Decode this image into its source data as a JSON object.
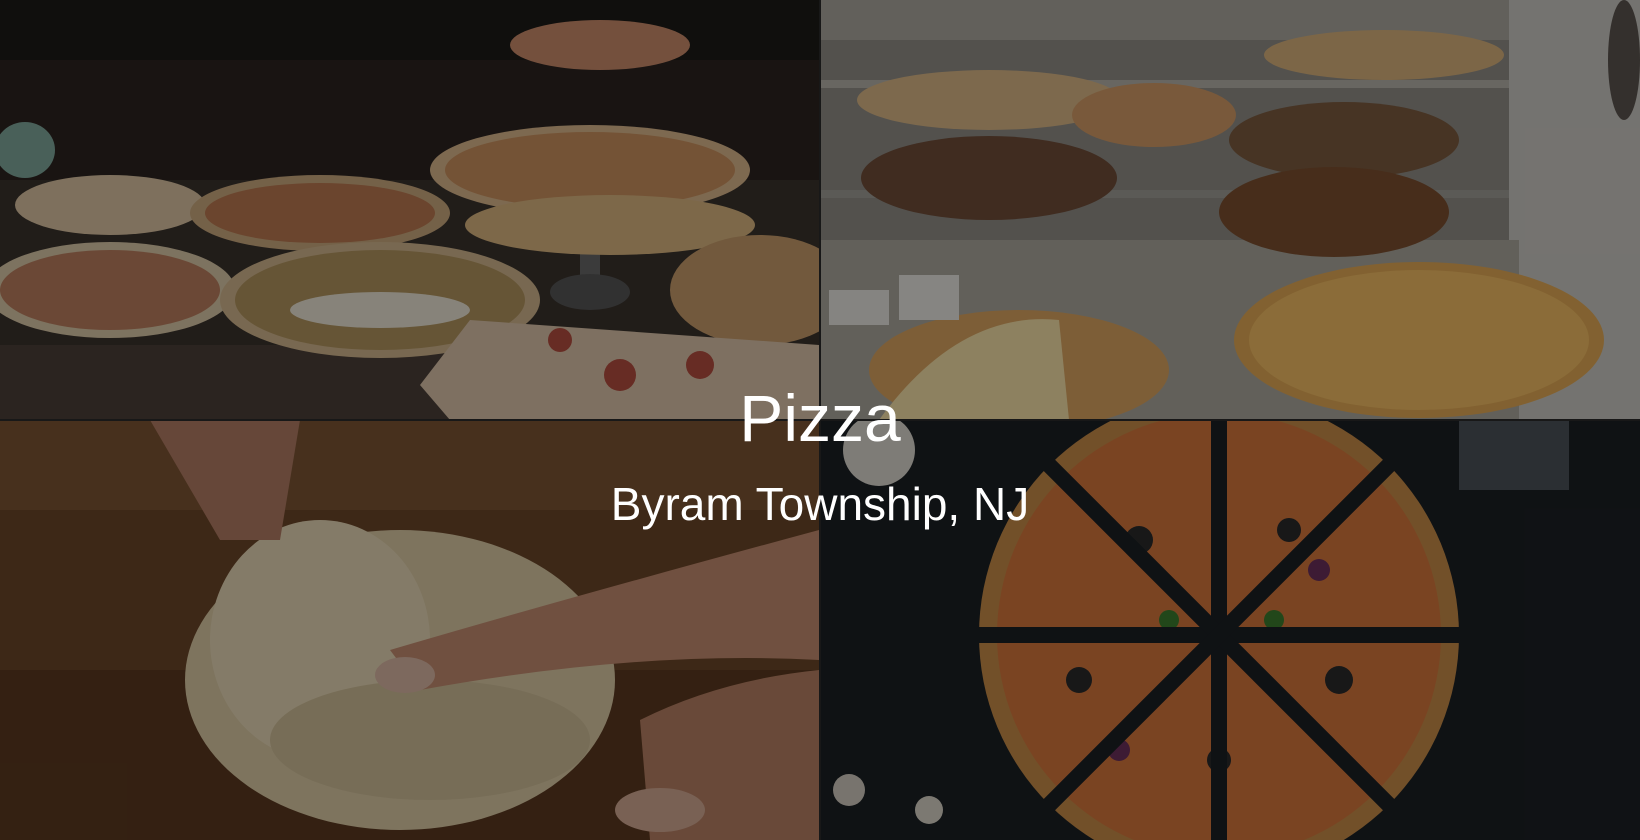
{
  "hero": {
    "title": "Pizza",
    "subtitle": "Byram Township, NJ"
  },
  "photos": [
    {
      "name": "pizza-counter-display-photo"
    },
    {
      "name": "pizza-shelf-case-photo"
    },
    {
      "name": "dough-kneading-photo"
    },
    {
      "name": "sliced-veggie-pizza-photo"
    }
  ],
  "colors": {
    "overlay": "#000000",
    "text": "#ffffff"
  }
}
